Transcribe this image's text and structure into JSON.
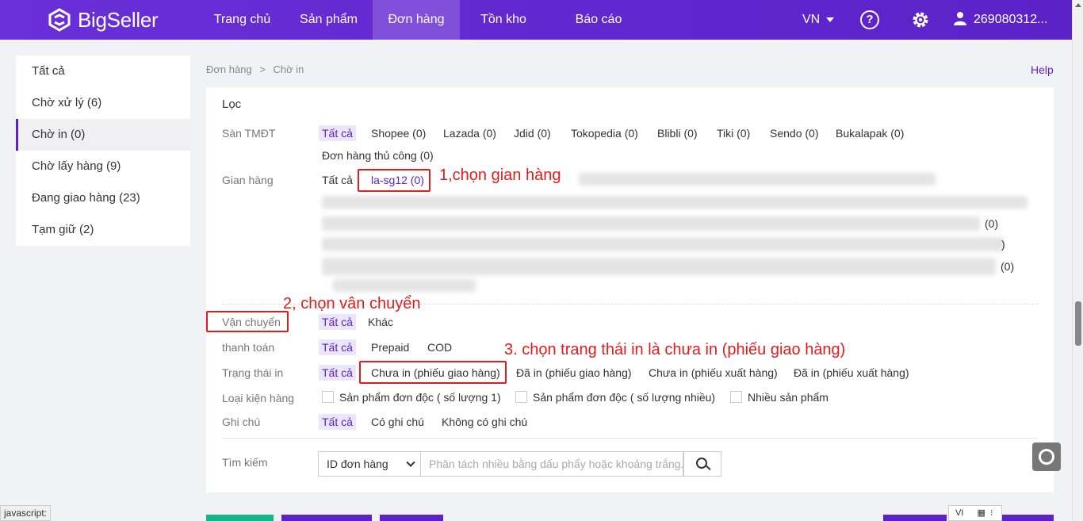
{
  "brand": {
    "name": "BigSeller"
  },
  "nav": {
    "items": [
      {
        "label": "Trang chủ"
      },
      {
        "label": "Sản phẩm"
      },
      {
        "label": "Đơn hàng"
      },
      {
        "label": "Tồn kho"
      },
      {
        "label": "Báo cáo"
      }
    ],
    "active_index": 2,
    "lang": "VN",
    "help_icon": "question-circle-icon",
    "settings_icon": "gear-icon",
    "user_icon": "user-icon",
    "user": "269080312..."
  },
  "sidebar": {
    "items": [
      {
        "label": "Tất cả"
      },
      {
        "label": "Chờ xử lý (6)"
      },
      {
        "label": "Chờ in (0)"
      },
      {
        "label": "Chờ lấy hàng (9)"
      },
      {
        "label": "Đang giao hàng (23)"
      },
      {
        "label": "Tạm giữ (2)"
      }
    ],
    "active_index": 2
  },
  "breadcrumb": {
    "parent": "Đơn hàng",
    "sep": ">",
    "current": "Chờ in"
  },
  "help": "Help",
  "filter": {
    "title": "Lọc",
    "marketplace": {
      "label": "Sàn TMĐT",
      "options": [
        "Tất cả",
        "Shopee (0)",
        "Lazada (0)",
        "Jdid (0)",
        "Tokopedia (0)",
        "Blibli (0)",
        "Tiki (0)",
        "Sendo (0)",
        "Bukalapak (0)"
      ],
      "manual": "Đơn hàng thủ công (0)"
    },
    "store": {
      "label": "Gian hàng",
      "all": "Tất cả",
      "selected": "la-sg12 (0)",
      "row3_tail": "(0)",
      "row4_tail": ")",
      "row5_tail": "(0)"
    },
    "shipping": {
      "label": "Vận chuyển",
      "options": [
        "Tất cả",
        "Khác"
      ]
    },
    "payment": {
      "label": "thanh toán",
      "options": [
        "Tất cả",
        "Prepaid",
        "COD"
      ]
    },
    "print_status": {
      "label": "Trạng thái in",
      "options": [
        "Tất cả",
        "Chưa in (phiếu giao hàng)",
        "Đã in (phiếu giao hàng)",
        "Chưa in (phiếu xuất hàng)",
        "Đã in (phiếu xuất hàng)"
      ]
    },
    "package_type": {
      "label": "Loại kiện hàng",
      "options": [
        "Sản phẩm đơn độc ( số lượng 1)",
        "Sản phẩm đơn độc ( số lượng nhiều)",
        "Nhiều sản phẩm"
      ]
    },
    "note": {
      "label": "Ghi chú",
      "options": [
        "Tất cả",
        "Có ghi chú",
        "Không có ghi chú"
      ]
    },
    "search": {
      "label": "Tìm kiếm",
      "field": "ID đơn hàng",
      "placeholder": "Phân tách nhiều bằng dấu phẩy hoặc khoảng trắng.",
      "icon": "search-icon"
    }
  },
  "annotations": {
    "step1": "1,chọn gian hàng",
    "step2": "2, chọn vân chuyển",
    "step3": "3. chọn trang thái in là chưa in (phiếu giao hàng)"
  },
  "statusbar": "javascript:",
  "ime": "VI",
  "colors": {
    "brand": "#5b22c8",
    "annotation": "#e31b1b"
  }
}
